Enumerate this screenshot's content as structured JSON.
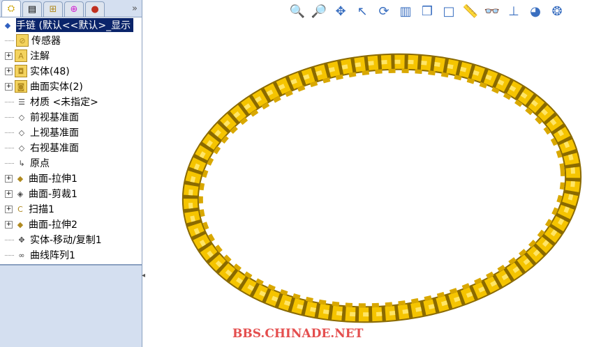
{
  "panel_tabs": [
    "feature-manager",
    "property-manager",
    "configuration-manager",
    "dimxpert-manager",
    "display-manager"
  ],
  "more_label": "»",
  "tree": {
    "root": "手链  (默认<<默认>_显示",
    "items": [
      {
        "label": "传感器",
        "expandable": false,
        "icon": "sensor-icon"
      },
      {
        "label": "注解",
        "expandable": true,
        "icon": "annotation-icon"
      },
      {
        "label": "实体(48)",
        "expandable": true,
        "icon": "solid-bodies-icon"
      },
      {
        "label": "曲面实体(2)",
        "expandable": true,
        "icon": "surface-bodies-icon"
      },
      {
        "label": "材质 <未指定>",
        "expandable": false,
        "icon": "material-icon"
      },
      {
        "label": "前视基准面",
        "expandable": false,
        "icon": "plane-icon"
      },
      {
        "label": "上视基准面",
        "expandable": false,
        "icon": "plane-icon"
      },
      {
        "label": "右视基准面",
        "expandable": false,
        "icon": "plane-icon"
      },
      {
        "label": "原点",
        "expandable": false,
        "icon": "origin-icon"
      },
      {
        "label": "曲面-拉伸1",
        "expandable": true,
        "icon": "surface-extrude-icon"
      },
      {
        "label": "曲面-剪裁1",
        "expandable": true,
        "icon": "surface-trim-icon"
      },
      {
        "label": "扫描1",
        "expandable": true,
        "icon": "sweep-icon"
      },
      {
        "label": "曲面-拉伸2",
        "expandable": true,
        "icon": "surface-extrude-icon"
      },
      {
        "label": "实体-移动/复制1",
        "expandable": false,
        "icon": "move-copy-icon"
      },
      {
        "label": "曲线阵列1",
        "expandable": false,
        "icon": "curve-pattern-icon"
      }
    ]
  },
  "toolbar": [
    "zoom-to-fit",
    "zoom-to-area",
    "pan",
    "previous-view",
    "rotate",
    "section-view",
    "view-orientation",
    "display-style",
    "measure",
    "hide-show",
    "apply-scene",
    "appearance",
    "render-tools"
  ],
  "watermark": "BBS.CHINADE.NET",
  "colors": {
    "chain": "#f5c400",
    "chain_dark": "#b08a00",
    "selection": "#0a246a"
  }
}
